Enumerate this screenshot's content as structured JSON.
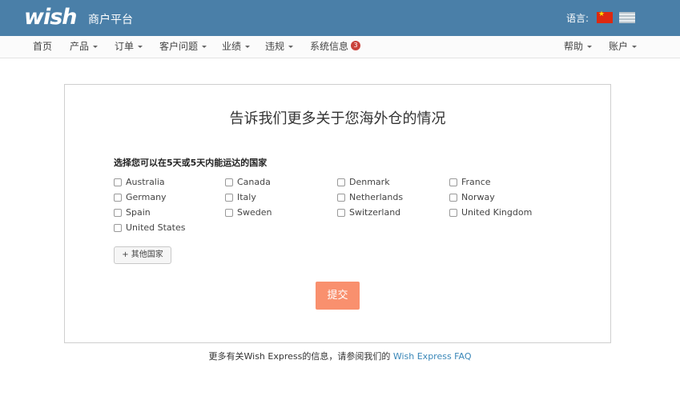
{
  "header": {
    "logo_text": "wish",
    "portal_title": "商户平台",
    "language_label": "语言:",
    "flags": [
      {
        "name": "china-flag-icon",
        "color": "#de2910"
      },
      {
        "name": "usa-flag-icon",
        "color": "#b8c4cc"
      }
    ]
  },
  "nav": {
    "home": "首页",
    "products": "产品",
    "orders": "订单",
    "customer_issues": "客户问题",
    "performance": "业绩",
    "violations": "违规",
    "system_info": "系统信息",
    "system_info_badge": "3",
    "help": "帮助",
    "account": "账户"
  },
  "main": {
    "title": "告诉我们更多关于您海外仓的情况",
    "section_label": "选择您可以在5天或5天内能运达的国家",
    "countries": [
      {
        "label": "Australia",
        "checked": false
      },
      {
        "label": "Canada",
        "checked": false
      },
      {
        "label": "Denmark",
        "checked": false
      },
      {
        "label": "France",
        "checked": false
      },
      {
        "label": "Germany",
        "checked": false
      },
      {
        "label": "Italy",
        "checked": false
      },
      {
        "label": "Netherlands",
        "checked": false
      },
      {
        "label": "Norway",
        "checked": false
      },
      {
        "label": "Spain",
        "checked": false
      },
      {
        "label": "Sweden",
        "checked": false
      },
      {
        "label": "Switzerland",
        "checked": false
      },
      {
        "label": "United Kingdom",
        "checked": false
      },
      {
        "label": "United States",
        "checked": false
      }
    ],
    "add_country_button": "+ 其他国家",
    "submit_button": "提交"
  },
  "footer": {
    "text": "更多有关Wish Express的信息，请参阅我们的",
    "link": "Wish Express FAQ"
  },
  "colors": {
    "header_bg": "#4a7fa8",
    "submit_bg": "#f9906e",
    "link": "#3a87b8",
    "badge": "#c9423a"
  }
}
